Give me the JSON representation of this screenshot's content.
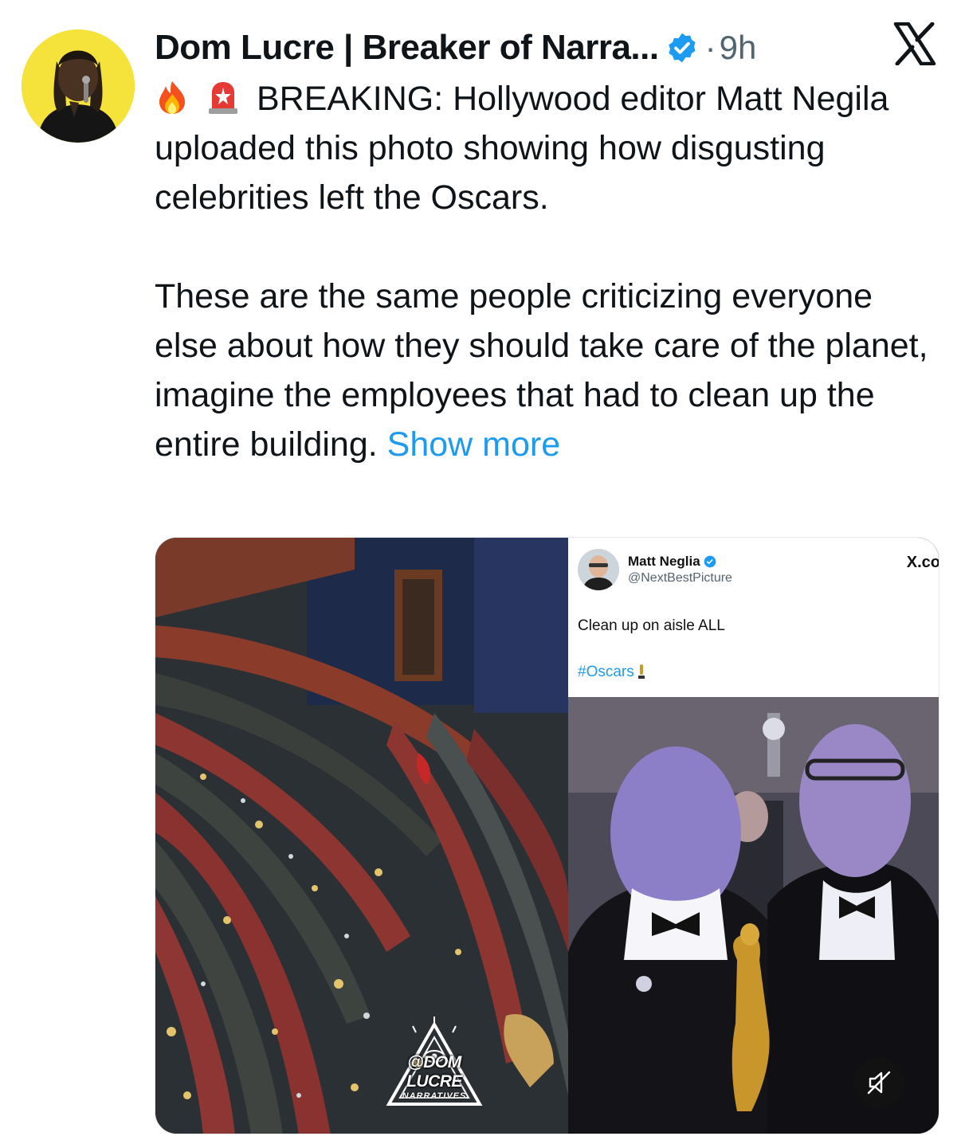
{
  "tweet": {
    "author_name": "Dom Lucre | Breaker of Narra...",
    "separator": "·",
    "time": "9h",
    "body": {
      "line1": "BREAKING: Hollywood editor Matt Negila uploaded this photo showing how disgusting celebrities left the Oscars.",
      "line2": "These are the same people criticizing everyone else about how they should take care of the planet, imagine the employees that had to clean up the entire building.",
      "show_more": "Show more"
    },
    "emojis": [
      "fire-emoji",
      "police-light-emoji"
    ]
  },
  "embedded_post": {
    "name": "Matt Neglia",
    "handle": "@NextBestPicture",
    "site": "X.co",
    "text": "Clean up on aisle ALL",
    "hashtag": "#Oscars"
  },
  "watermark": {
    "main": "@DOM LUCRE",
    "sub": "NARRATIVES"
  },
  "colors": {
    "accent": "#1d9bf0",
    "text": "#0f1419",
    "secondary": "#536471",
    "avatar_bg": "#f5e23a"
  }
}
